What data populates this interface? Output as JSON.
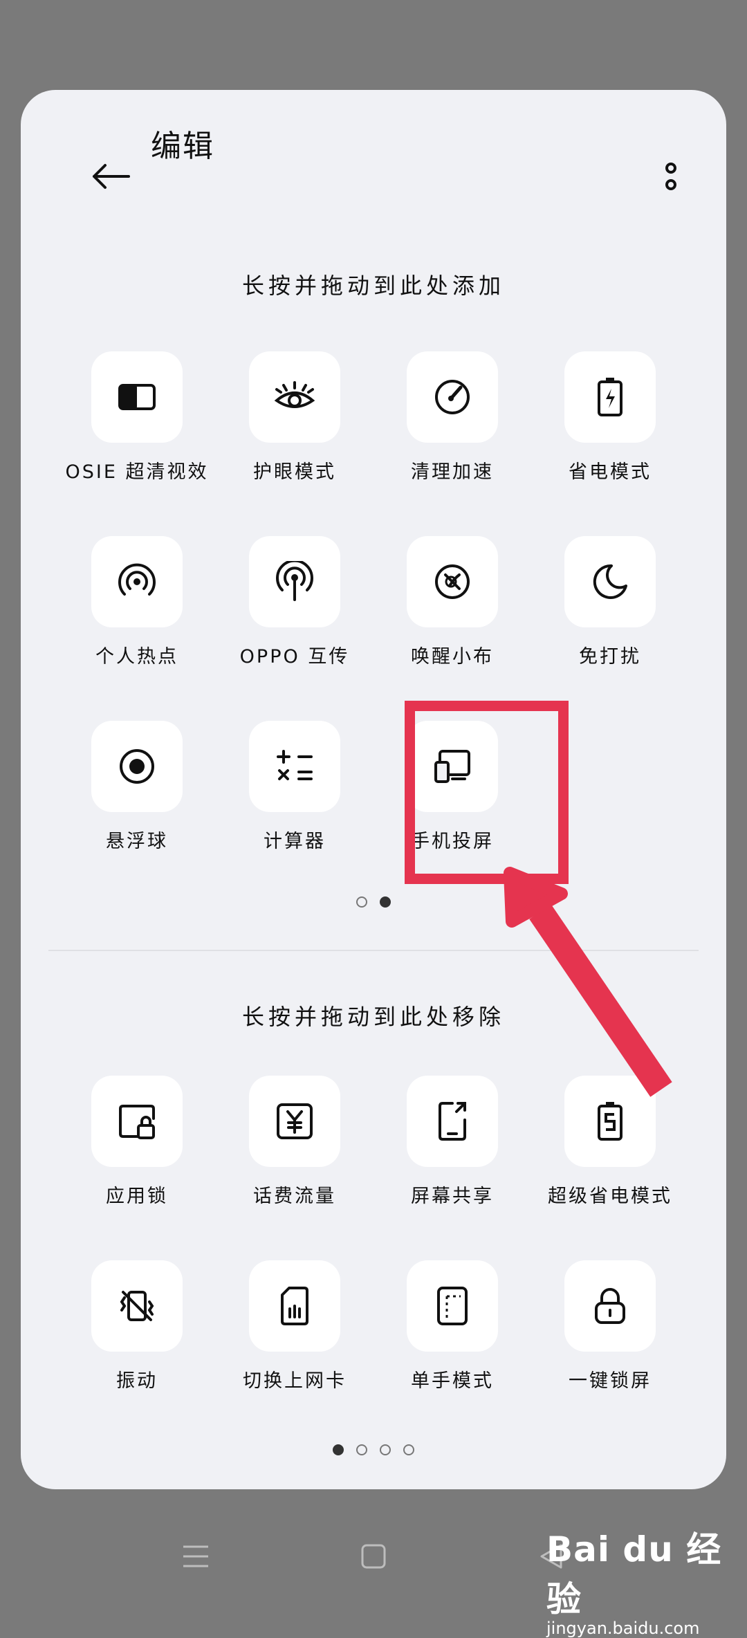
{
  "header": {
    "title": "编辑"
  },
  "add_section": {
    "title": "长按并拖动到此处添加",
    "tiles": [
      {
        "label": "OSIE 超清视效",
        "icon": "display-enhance-icon"
      },
      {
        "label": "护眼模式",
        "icon": "eye-icon"
      },
      {
        "label": "清理加速",
        "icon": "speedometer-icon"
      },
      {
        "label": "省电模式",
        "icon": "battery-icon"
      },
      {
        "label": "个人热点",
        "icon": "hotspot-icon"
      },
      {
        "label": "OPPO 互传",
        "icon": "share-antenna-icon"
      },
      {
        "label": "唤醒小布",
        "icon": "assistant-icon"
      },
      {
        "label": "免打扰",
        "icon": "moon-icon"
      },
      {
        "label": "悬浮球",
        "icon": "floating-ball-icon"
      },
      {
        "label": "计算器",
        "icon": "calculator-icon"
      },
      {
        "label": "手机投屏",
        "icon": "screen-cast-icon"
      }
    ],
    "page_count": 2,
    "active_page": 2
  },
  "remove_section": {
    "title": "长按并拖动到此处移除",
    "tiles": [
      {
        "label": "应用锁",
        "icon": "app-lock-icon"
      },
      {
        "label": "话费流量",
        "icon": "yuan-icon"
      },
      {
        "label": "屏幕共享",
        "icon": "screen-share-icon"
      },
      {
        "label": "超级省电模式",
        "icon": "super-battery-icon"
      },
      {
        "label": "振动",
        "icon": "vibrate-icon"
      },
      {
        "label": "切换上网卡",
        "icon": "sim-card-icon"
      },
      {
        "label": "单手模式",
        "icon": "one-hand-icon"
      },
      {
        "label": "一键锁屏",
        "icon": "lock-icon"
      }
    ],
    "page_count": 4,
    "active_page": 1
  },
  "annotation": {
    "color": "#e5344f"
  },
  "watermark": {
    "brand": "Bai du 经验",
    "url": "jingyan.baidu.com"
  }
}
